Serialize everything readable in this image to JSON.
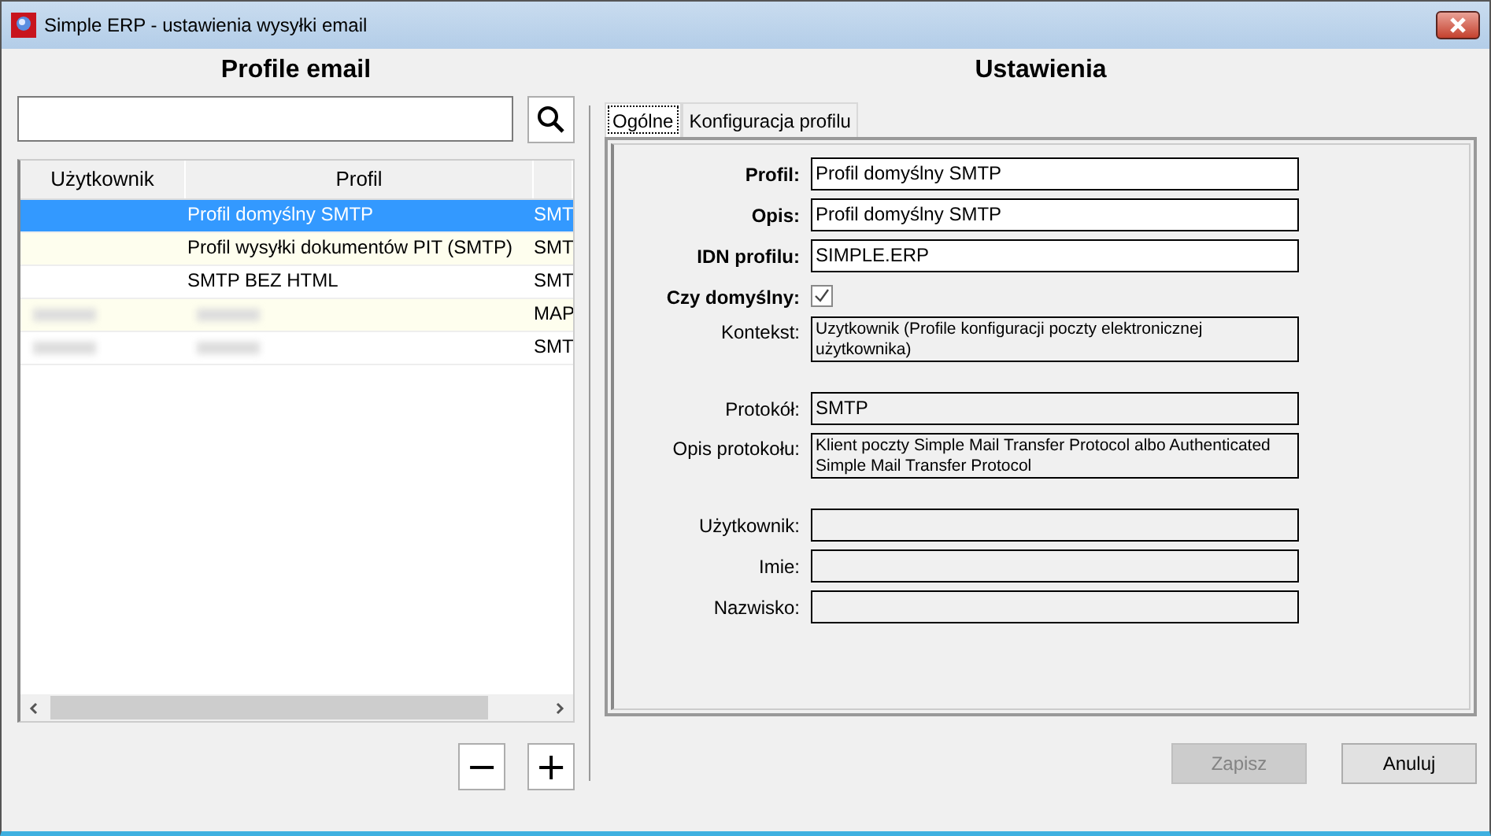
{
  "window": {
    "title": "Simple ERP - ustawienia wysyłki email"
  },
  "left": {
    "heading": "Profile email",
    "table": {
      "columns": [
        "Użytkownik",
        "Profil"
      ],
      "rows": [
        {
          "cells": [
            "",
            "Profil domyślny SMTP",
            "SMT"
          ],
          "selected": true,
          "redacted": false
        },
        {
          "cells": [
            "",
            "Profil wysyłki dokumentów PIT (SMTP)",
            "SMT"
          ],
          "selected": false,
          "redacted": false
        },
        {
          "cells": [
            "",
            "SMTP BEZ HTML",
            "SMT"
          ],
          "selected": false,
          "redacted": false
        },
        {
          "cells": [
            "",
            "",
            "MAP"
          ],
          "selected": false,
          "redacted": true
        },
        {
          "cells": [
            "",
            "",
            "SMT"
          ],
          "selected": false,
          "redacted": true
        }
      ]
    },
    "buttons": [
      "−",
      "+"
    ]
  },
  "right": {
    "heading": "Ustawienia",
    "tabs": [
      {
        "label": "Ogólne",
        "selected": true
      },
      {
        "label": "Konfiguracja profilu",
        "selected": false
      }
    ],
    "fields": [
      {
        "kind": "text",
        "label": "Profil:",
        "value": "Profil domyślny SMTP",
        "bold": true,
        "editable": true
      },
      {
        "kind": "text",
        "label": "Opis:",
        "value": "Profil domyślny SMTP",
        "bold": true,
        "editable": true
      },
      {
        "kind": "text",
        "label": "IDN profilu:",
        "value": "SIMPLE.ERP",
        "bold": true,
        "editable": true
      },
      {
        "kind": "checkbox",
        "label": "Czy domyślny:",
        "checked": true,
        "bold": true
      },
      {
        "kind": "area",
        "label": "Kontekst:",
        "value": "Uzytkownik (Profile konfiguracji poczty elektronicznej użytkownika)",
        "bold": false,
        "editable": false
      },
      {
        "kind": "spacer"
      },
      {
        "kind": "text",
        "label": "Protokół:",
        "value": "SMTP",
        "bold": false,
        "editable": false
      },
      {
        "kind": "area",
        "label": "Opis protokołu:",
        "value": "Klient poczty Simple Mail Transfer Protocol albo Authenticated Simple Mail Transfer Protocol",
        "bold": false,
        "editable": false
      },
      {
        "kind": "spacer"
      },
      {
        "kind": "text",
        "label": "Użytkownik:",
        "bold": false,
        "editable": false
      },
      {
        "kind": "text",
        "label": "Imie:",
        "bold": false,
        "editable": false
      },
      {
        "kind": "text",
        "label": "Nazwisko:",
        "bold": false,
        "editable": false
      }
    ]
  },
  "buttons": [
    {
      "label": "Zapisz",
      "disabled": true
    },
    {
      "label": "Anuluj",
      "disabled": false
    }
  ]
}
